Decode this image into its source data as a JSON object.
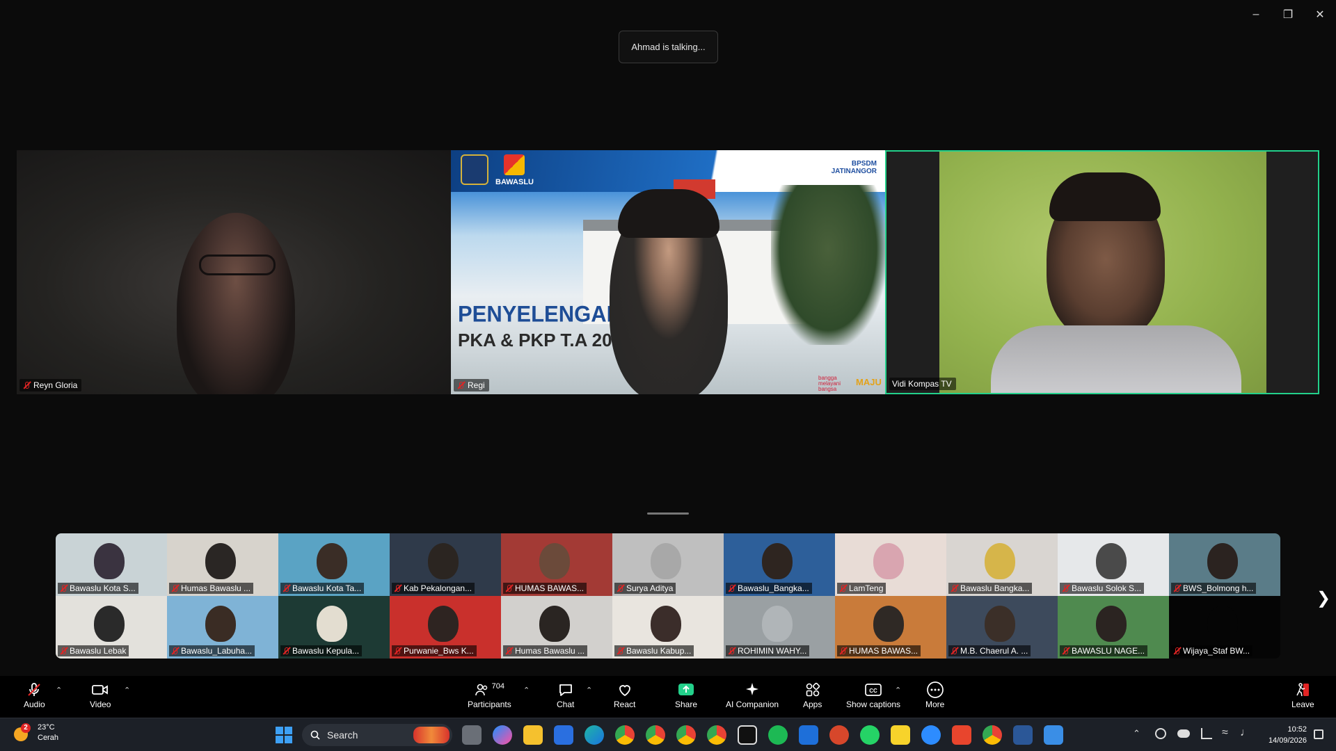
{
  "window": {
    "minimize": "–",
    "restore": "❐",
    "close": "✕"
  },
  "status": {
    "talking": "Ahmad is talking..."
  },
  "main_tiles": [
    {
      "name": "Reyn Gloria",
      "muted": true
    },
    {
      "name": "Regi",
      "muted": true,
      "slide": {
        "org": "BAWASLU",
        "title_line1": "PENYELENGARAAN",
        "title_line2": "PKA & PKP T.A 2026",
        "badge": "BPSDM JATINANGOR",
        "tagline": "bangga melayani bangsa",
        "footer_brand": "MAJU"
      }
    },
    {
      "name": "Vidi Kompas TV",
      "muted": false,
      "active_speaker": true
    }
  ],
  "gallery": [
    {
      "name": "Bawaslu Kota S...",
      "bg": "#c9d3d6",
      "face": "#3a3340"
    },
    {
      "name": "Humas Bawaslu ...",
      "bg": "#d7d3cc",
      "face": "#2a2624"
    },
    {
      "name": "Bawaslu Kota Ta...",
      "bg": "#5aa3c4",
      "face": "#3a2d26"
    },
    {
      "name": "Kab Pekalongan...",
      "bg": "#2f3a4a",
      "face": "#2b2521"
    },
    {
      "name": "HUMAS BAWAS...",
      "bg": "#a33a35",
      "face": "#6b4a3a"
    },
    {
      "name": "Surya Aditya",
      "bg": "#bfbfbf",
      "face": "#a8a8a8"
    },
    {
      "name": "Bawaslu_Bangka...",
      "bg": "#2d5f9a",
      "face": "#2e2520"
    },
    {
      "name": "LamTeng",
      "bg": "#e8dcd6",
      "face": "#d9a5b0"
    },
    {
      "name": "Bawaslu Bangka...",
      "bg": "#d9d5d1",
      "face": "#d6b54a"
    },
    {
      "name": "Bawaslu Solok S...",
      "bg": "#e6e8ea",
      "face": "#4a4a4a"
    },
    {
      "name": "BWS_Bolmong h...",
      "bg": "#5a7c88",
      "face": "#2b2320"
    },
    {
      "name": "Bawaslu Lebak",
      "bg": "#e3e1dc",
      "face": "#2a2a2a"
    },
    {
      "name": "Bawaslu_Labuha...",
      "bg": "#7fb3d6",
      "face": "#3a2c24"
    },
    {
      "name": "Bawaslu Kepula...",
      "bg": "#1d3a34",
      "face": "#e3ddd0"
    },
    {
      "name": "Purwanie_Bws K...",
      "bg": "#c9302c",
      "face": "#2e2421"
    },
    {
      "name": "Humas Bawaslu ...",
      "bg": "#d2d0cd",
      "face": "#2a2522"
    },
    {
      "name": "Bawaslu Kabup...",
      "bg": "#e9e5df",
      "face": "#3b2d2a"
    },
    {
      "name": "ROHIMIN WAHY...",
      "bg": "#9aa0a3",
      "face": "#b0b5b8"
    },
    {
      "name": "HUMAS BAWAS...",
      "bg": "#c97b3a",
      "face": "#2f2925"
    },
    {
      "name": "M.B. Chaerul A. ...",
      "bg": "#3d4a5c",
      "face": "#3b2f28"
    },
    {
      "name": "BAWASLU NAGE...",
      "bg": "#4f8a4f",
      "face": "#2b2421"
    },
    {
      "name": "Wijaya_Staf BW...",
      "bg": "#050505",
      "face": "#050505"
    }
  ],
  "toolbar": {
    "audio": "Audio",
    "video": "Video",
    "participants": "Participants",
    "participant_count": "704",
    "chat": "Chat",
    "react": "React",
    "share": "Share",
    "ai_companion": "AI Companion",
    "apps": "Apps",
    "show_captions": "Show captions",
    "more": "More",
    "leave": "Leave"
  },
  "taskbar": {
    "weather_temp": "23°C",
    "weather_cond": "Cerah",
    "weather_badge": "2",
    "search_label": "Search",
    "time": "10:52",
    "date": "14/09/2026"
  },
  "colors": {
    "active_border": "#23d18b",
    "muted_red": "#e02424",
    "share_green": "#23d18b"
  }
}
